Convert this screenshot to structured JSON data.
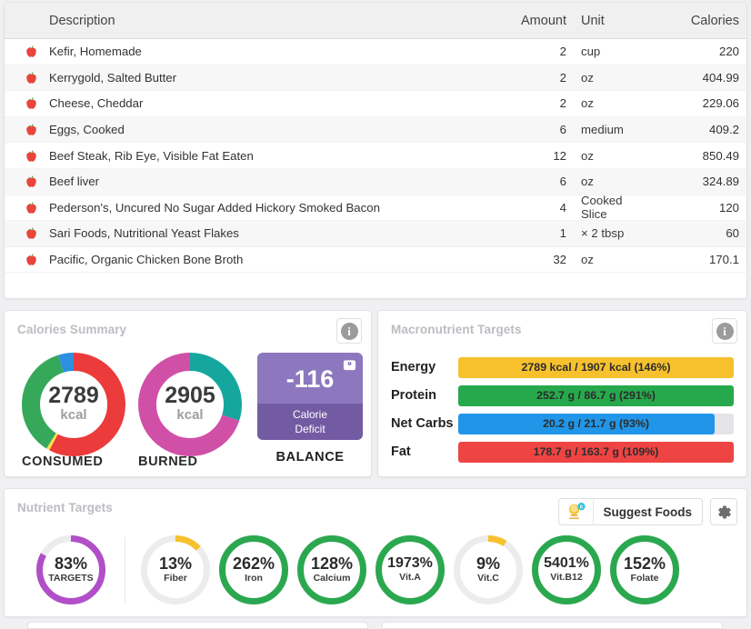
{
  "food_table": {
    "columns": {
      "description": "Description",
      "amount": "Amount",
      "unit": "Unit",
      "calories": "Calories"
    },
    "rows": [
      {
        "icon": "apple-icon",
        "description": "Kefir, Homemade",
        "amount": "2",
        "unit": "cup",
        "calories": "220"
      },
      {
        "icon": "apple-icon",
        "description": "Kerrygold, Salted Butter",
        "amount": "2",
        "unit": "oz",
        "calories": "404.99"
      },
      {
        "icon": "apple-icon",
        "description": "Cheese, Cheddar",
        "amount": "2",
        "unit": "oz",
        "calories": "229.06"
      },
      {
        "icon": "apple-icon",
        "description": "Eggs, Cooked",
        "amount": "6",
        "unit": "medium",
        "calories": "409.2"
      },
      {
        "icon": "apple-icon",
        "description": "Beef Steak, Rib Eye, Visible Fat Eaten",
        "amount": "12",
        "unit": "oz",
        "calories": "850.49"
      },
      {
        "icon": "apple-icon",
        "description": "Beef liver",
        "amount": "6",
        "unit": "oz",
        "calories": "324.89"
      },
      {
        "icon": "apple-icon",
        "description": "Pederson's, Uncured No Sugar Added Hickory Smoked Bacon",
        "amount": "4",
        "unit": "Cooked Slice",
        "calories": "120"
      },
      {
        "icon": "apple-icon",
        "description": "Sari Foods, Nutritional Yeast Flakes",
        "amount": "1",
        "unit": "× 2 tbsp",
        "calories": "60"
      },
      {
        "icon": "apple-icon",
        "description": "Pacific, Organic Chicken Bone Broth",
        "amount": "32",
        "unit": "oz",
        "calories": "170.1"
      }
    ]
  },
  "calories_summary": {
    "title": "Calories Summary",
    "info_icon": "info-icon",
    "consumed": {
      "value": "2789",
      "unit": "kcal",
      "caption": "CONSUMED",
      "segments": [
        {
          "name": "fat",
          "percent": 57.7,
          "color": "#eb3b3b"
        },
        {
          "name": "alcohol",
          "percent": 1.0,
          "color": "#f5e04a"
        },
        {
          "name": "protein",
          "percent": 36.3,
          "color": "#36a85a"
        },
        {
          "name": "carbs",
          "percent": 5.0,
          "color": "#2d8fe0"
        }
      ]
    },
    "burned": {
      "value": "2905",
      "unit": "kcal",
      "caption": "BURNED",
      "segments": [
        {
          "name": "active",
          "percent": 30.0,
          "color": "#15a79d"
        },
        {
          "name": "basal",
          "percent": 70.0,
          "color": "#d150a7"
        }
      ]
    },
    "balance": {
      "value": "-116",
      "status_line1": "Calorie",
      "status_line2": "Deficit",
      "caption": "BALANCE",
      "icon": "scale-icon",
      "top_color": "#8d78bf",
      "bottom_color": "#735ba3"
    }
  },
  "macronutrient_targets": {
    "title": "Macronutrient Targets",
    "info_icon": "info-icon",
    "rows": [
      {
        "name": "Energy",
        "text": "2789 kcal / 1907 kcal (146%)",
        "percent": 100,
        "color": "#f7c12e"
      },
      {
        "name": "Protein",
        "text": "252.7 g / 86.7 g (291%)",
        "percent": 100,
        "color": "#26a94c"
      },
      {
        "name": "Net Carbs",
        "text": "20.2 g / 21.7 g (93%)",
        "percent": 93,
        "color": "#2196e8"
      },
      {
        "name": "Fat",
        "text": "178.7 g / 163.7 g (109%)",
        "percent": 100,
        "color": "#ef4444"
      }
    ]
  },
  "nutrient_targets": {
    "title": "Nutrient Targets",
    "suggest_button": {
      "label": "Suggest Foods",
      "icon": "lightbulb-icon"
    },
    "settings_button": {
      "icon": "gear-icon"
    },
    "overall": {
      "percent_label": "83%",
      "name": "TARGETS",
      "percent": 83,
      "color": "#b04fc8"
    },
    "items": [
      {
        "percent_label": "13%",
        "name": "Fiber",
        "percent": 13,
        "color": "#f7c12e"
      },
      {
        "percent_label": "262%",
        "name": "Iron",
        "percent": 100,
        "color": "#2ba84f"
      },
      {
        "percent_label": "128%",
        "name": "Calcium",
        "percent": 100,
        "color": "#2ba84f"
      },
      {
        "percent_label": "1973%",
        "name": "Vit.A",
        "percent": 100,
        "color": "#2ba84f"
      },
      {
        "percent_label": "9%",
        "name": "Vit.C",
        "percent": 9,
        "color": "#f7c12e"
      },
      {
        "percent_label": "5401%",
        "name": "Vit.B12",
        "percent": 100,
        "color": "#2ba84f"
      },
      {
        "percent_label": "152%",
        "name": "Folate",
        "percent": 100,
        "color": "#2ba84f"
      }
    ]
  }
}
